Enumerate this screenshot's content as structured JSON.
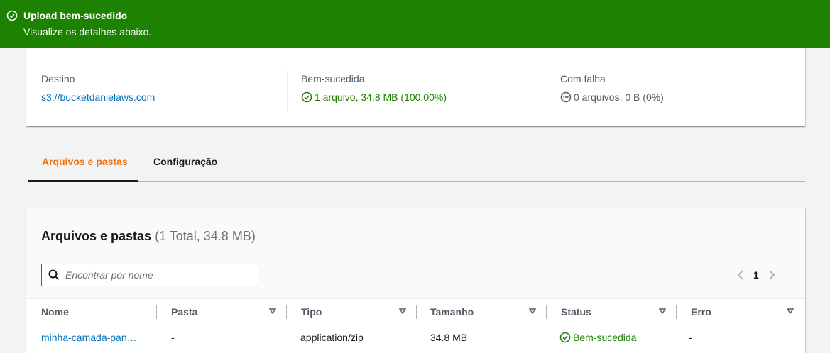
{
  "flash": {
    "title": "Upload bem-sucedido",
    "subtitle": "Visualize os detalhes abaixo.",
    "color": "#1d8102",
    "icon": "check-circle-icon"
  },
  "summary": {
    "destination": {
      "label": "Destino",
      "value": "s3://bucketdanielaws.com"
    },
    "succeeded": {
      "label": "Bem-sucedida",
      "value": "1 arquivo, 34.8 MB (100.00%)",
      "icon": "check-circle-icon"
    },
    "failed": {
      "label": "Com falha",
      "value": "0 arquivos, 0 B (0%)",
      "icon": "ellipsis-circle-icon"
    }
  },
  "tabs": [
    {
      "label": "Arquivos e pastas",
      "active": true
    },
    {
      "label": "Configuração",
      "active": false
    }
  ],
  "files": {
    "title": "Arquivos e pastas",
    "count": "(1 Total, 34.8 MB)",
    "search_placeholder": "Encontrar por nome",
    "page": "1",
    "columns": [
      "Nome",
      "Pasta",
      "Tipo",
      "Tamanho",
      "Status",
      "Erro"
    ],
    "rows": [
      {
        "name": "minha-camada-pan…",
        "folder": "-",
        "type": "application/zip",
        "size": "34.8 MB",
        "status": "Bem-sucedida",
        "error": "-"
      }
    ]
  },
  "colors": {
    "accent": "#ec7211",
    "link": "#0073bb",
    "success": "#1d8102"
  }
}
